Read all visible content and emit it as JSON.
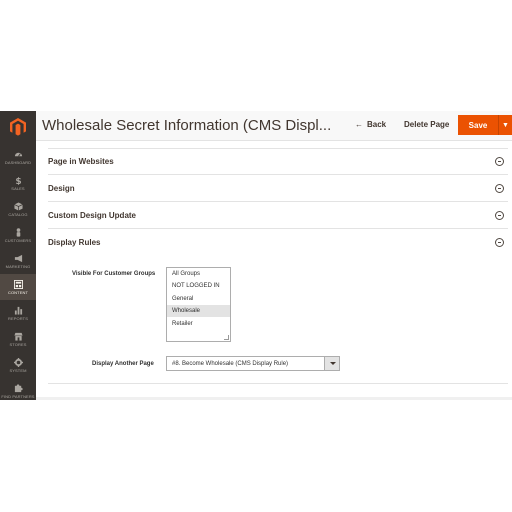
{
  "header": {
    "title": "Wholesale Secret Information (CMS Displ...",
    "back_label": "Back",
    "delete_label": "Delete Page",
    "save_label": "Save"
  },
  "sidebar": {
    "items": [
      {
        "label": "DASHBOARD",
        "icon": "dashboard-icon"
      },
      {
        "label": "SALES",
        "icon": "dollar-icon"
      },
      {
        "label": "CATALOG",
        "icon": "cube-icon"
      },
      {
        "label": "CUSTOMERS",
        "icon": "person-icon"
      },
      {
        "label": "MARKETING",
        "icon": "megaphone-icon"
      },
      {
        "label": "CONTENT",
        "icon": "layout-icon",
        "active": true
      },
      {
        "label": "REPORTS",
        "icon": "bar-chart-icon"
      },
      {
        "label": "STORES",
        "icon": "store-icon"
      },
      {
        "label": "SYSTEM",
        "icon": "gear-icon"
      },
      {
        "label": "FIND PARTNERS",
        "icon": "puzzle-icon"
      }
    ]
  },
  "sections": [
    {
      "title": "Page in Websites"
    },
    {
      "title": "Design"
    },
    {
      "title": "Custom Design Update"
    },
    {
      "title": "Display Rules"
    }
  ],
  "display_rules": {
    "customer_groups_label": "Visible For Customer Groups",
    "customer_groups": [
      {
        "label": "All Groups",
        "selected": false
      },
      {
        "label": "NOT LOGGED IN",
        "selected": false
      },
      {
        "label": "General",
        "selected": false
      },
      {
        "label": "Wholesale",
        "selected": true
      },
      {
        "label": "Retailer",
        "selected": false
      }
    ],
    "another_page_label": "Display Another Page",
    "another_page_value": "#8. Become Wholesale (CMS Display Rule)"
  },
  "colors": {
    "accent": "#eb5202",
    "sidebar": "#373330",
    "sidebar_active": "#514943"
  }
}
